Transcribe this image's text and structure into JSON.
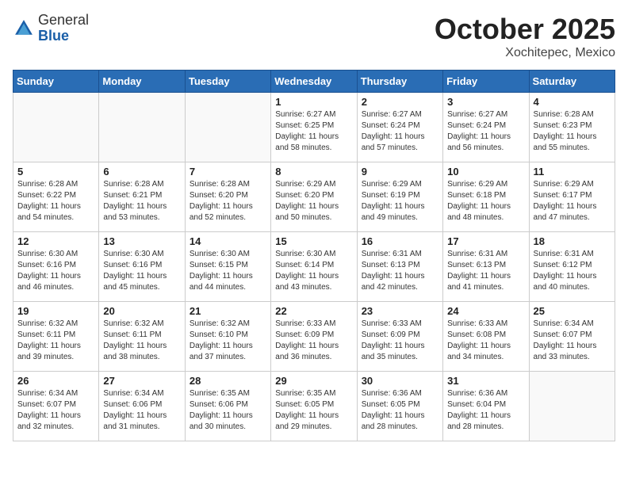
{
  "header": {
    "logo_general": "General",
    "logo_blue": "Blue",
    "month_title": "October 2025",
    "location": "Xochitepec, Mexico"
  },
  "days_of_week": [
    "Sunday",
    "Monday",
    "Tuesday",
    "Wednesday",
    "Thursday",
    "Friday",
    "Saturday"
  ],
  "weeks": [
    [
      {
        "day": "",
        "info": ""
      },
      {
        "day": "",
        "info": ""
      },
      {
        "day": "",
        "info": ""
      },
      {
        "day": "1",
        "info": "Sunrise: 6:27 AM\nSunset: 6:25 PM\nDaylight: 11 hours and 58 minutes."
      },
      {
        "day": "2",
        "info": "Sunrise: 6:27 AM\nSunset: 6:24 PM\nDaylight: 11 hours and 57 minutes."
      },
      {
        "day": "3",
        "info": "Sunrise: 6:27 AM\nSunset: 6:24 PM\nDaylight: 11 hours and 56 minutes."
      },
      {
        "day": "4",
        "info": "Sunrise: 6:28 AM\nSunset: 6:23 PM\nDaylight: 11 hours and 55 minutes."
      }
    ],
    [
      {
        "day": "5",
        "info": "Sunrise: 6:28 AM\nSunset: 6:22 PM\nDaylight: 11 hours and 54 minutes."
      },
      {
        "day": "6",
        "info": "Sunrise: 6:28 AM\nSunset: 6:21 PM\nDaylight: 11 hours and 53 minutes."
      },
      {
        "day": "7",
        "info": "Sunrise: 6:28 AM\nSunset: 6:20 PM\nDaylight: 11 hours and 52 minutes."
      },
      {
        "day": "8",
        "info": "Sunrise: 6:29 AM\nSunset: 6:20 PM\nDaylight: 11 hours and 50 minutes."
      },
      {
        "day": "9",
        "info": "Sunrise: 6:29 AM\nSunset: 6:19 PM\nDaylight: 11 hours and 49 minutes."
      },
      {
        "day": "10",
        "info": "Sunrise: 6:29 AM\nSunset: 6:18 PM\nDaylight: 11 hours and 48 minutes."
      },
      {
        "day": "11",
        "info": "Sunrise: 6:29 AM\nSunset: 6:17 PM\nDaylight: 11 hours and 47 minutes."
      }
    ],
    [
      {
        "day": "12",
        "info": "Sunrise: 6:30 AM\nSunset: 6:16 PM\nDaylight: 11 hours and 46 minutes."
      },
      {
        "day": "13",
        "info": "Sunrise: 6:30 AM\nSunset: 6:16 PM\nDaylight: 11 hours and 45 minutes."
      },
      {
        "day": "14",
        "info": "Sunrise: 6:30 AM\nSunset: 6:15 PM\nDaylight: 11 hours and 44 minutes."
      },
      {
        "day": "15",
        "info": "Sunrise: 6:30 AM\nSunset: 6:14 PM\nDaylight: 11 hours and 43 minutes."
      },
      {
        "day": "16",
        "info": "Sunrise: 6:31 AM\nSunset: 6:13 PM\nDaylight: 11 hours and 42 minutes."
      },
      {
        "day": "17",
        "info": "Sunrise: 6:31 AM\nSunset: 6:13 PM\nDaylight: 11 hours and 41 minutes."
      },
      {
        "day": "18",
        "info": "Sunrise: 6:31 AM\nSunset: 6:12 PM\nDaylight: 11 hours and 40 minutes."
      }
    ],
    [
      {
        "day": "19",
        "info": "Sunrise: 6:32 AM\nSunset: 6:11 PM\nDaylight: 11 hours and 39 minutes."
      },
      {
        "day": "20",
        "info": "Sunrise: 6:32 AM\nSunset: 6:11 PM\nDaylight: 11 hours and 38 minutes."
      },
      {
        "day": "21",
        "info": "Sunrise: 6:32 AM\nSunset: 6:10 PM\nDaylight: 11 hours and 37 minutes."
      },
      {
        "day": "22",
        "info": "Sunrise: 6:33 AM\nSunset: 6:09 PM\nDaylight: 11 hours and 36 minutes."
      },
      {
        "day": "23",
        "info": "Sunrise: 6:33 AM\nSunset: 6:09 PM\nDaylight: 11 hours and 35 minutes."
      },
      {
        "day": "24",
        "info": "Sunrise: 6:33 AM\nSunset: 6:08 PM\nDaylight: 11 hours and 34 minutes."
      },
      {
        "day": "25",
        "info": "Sunrise: 6:34 AM\nSunset: 6:07 PM\nDaylight: 11 hours and 33 minutes."
      }
    ],
    [
      {
        "day": "26",
        "info": "Sunrise: 6:34 AM\nSunset: 6:07 PM\nDaylight: 11 hours and 32 minutes."
      },
      {
        "day": "27",
        "info": "Sunrise: 6:34 AM\nSunset: 6:06 PM\nDaylight: 11 hours and 31 minutes."
      },
      {
        "day": "28",
        "info": "Sunrise: 6:35 AM\nSunset: 6:06 PM\nDaylight: 11 hours and 30 minutes."
      },
      {
        "day": "29",
        "info": "Sunrise: 6:35 AM\nSunset: 6:05 PM\nDaylight: 11 hours and 29 minutes."
      },
      {
        "day": "30",
        "info": "Sunrise: 6:36 AM\nSunset: 6:05 PM\nDaylight: 11 hours and 28 minutes."
      },
      {
        "day": "31",
        "info": "Sunrise: 6:36 AM\nSunset: 6:04 PM\nDaylight: 11 hours and 28 minutes."
      },
      {
        "day": "",
        "info": ""
      }
    ]
  ]
}
